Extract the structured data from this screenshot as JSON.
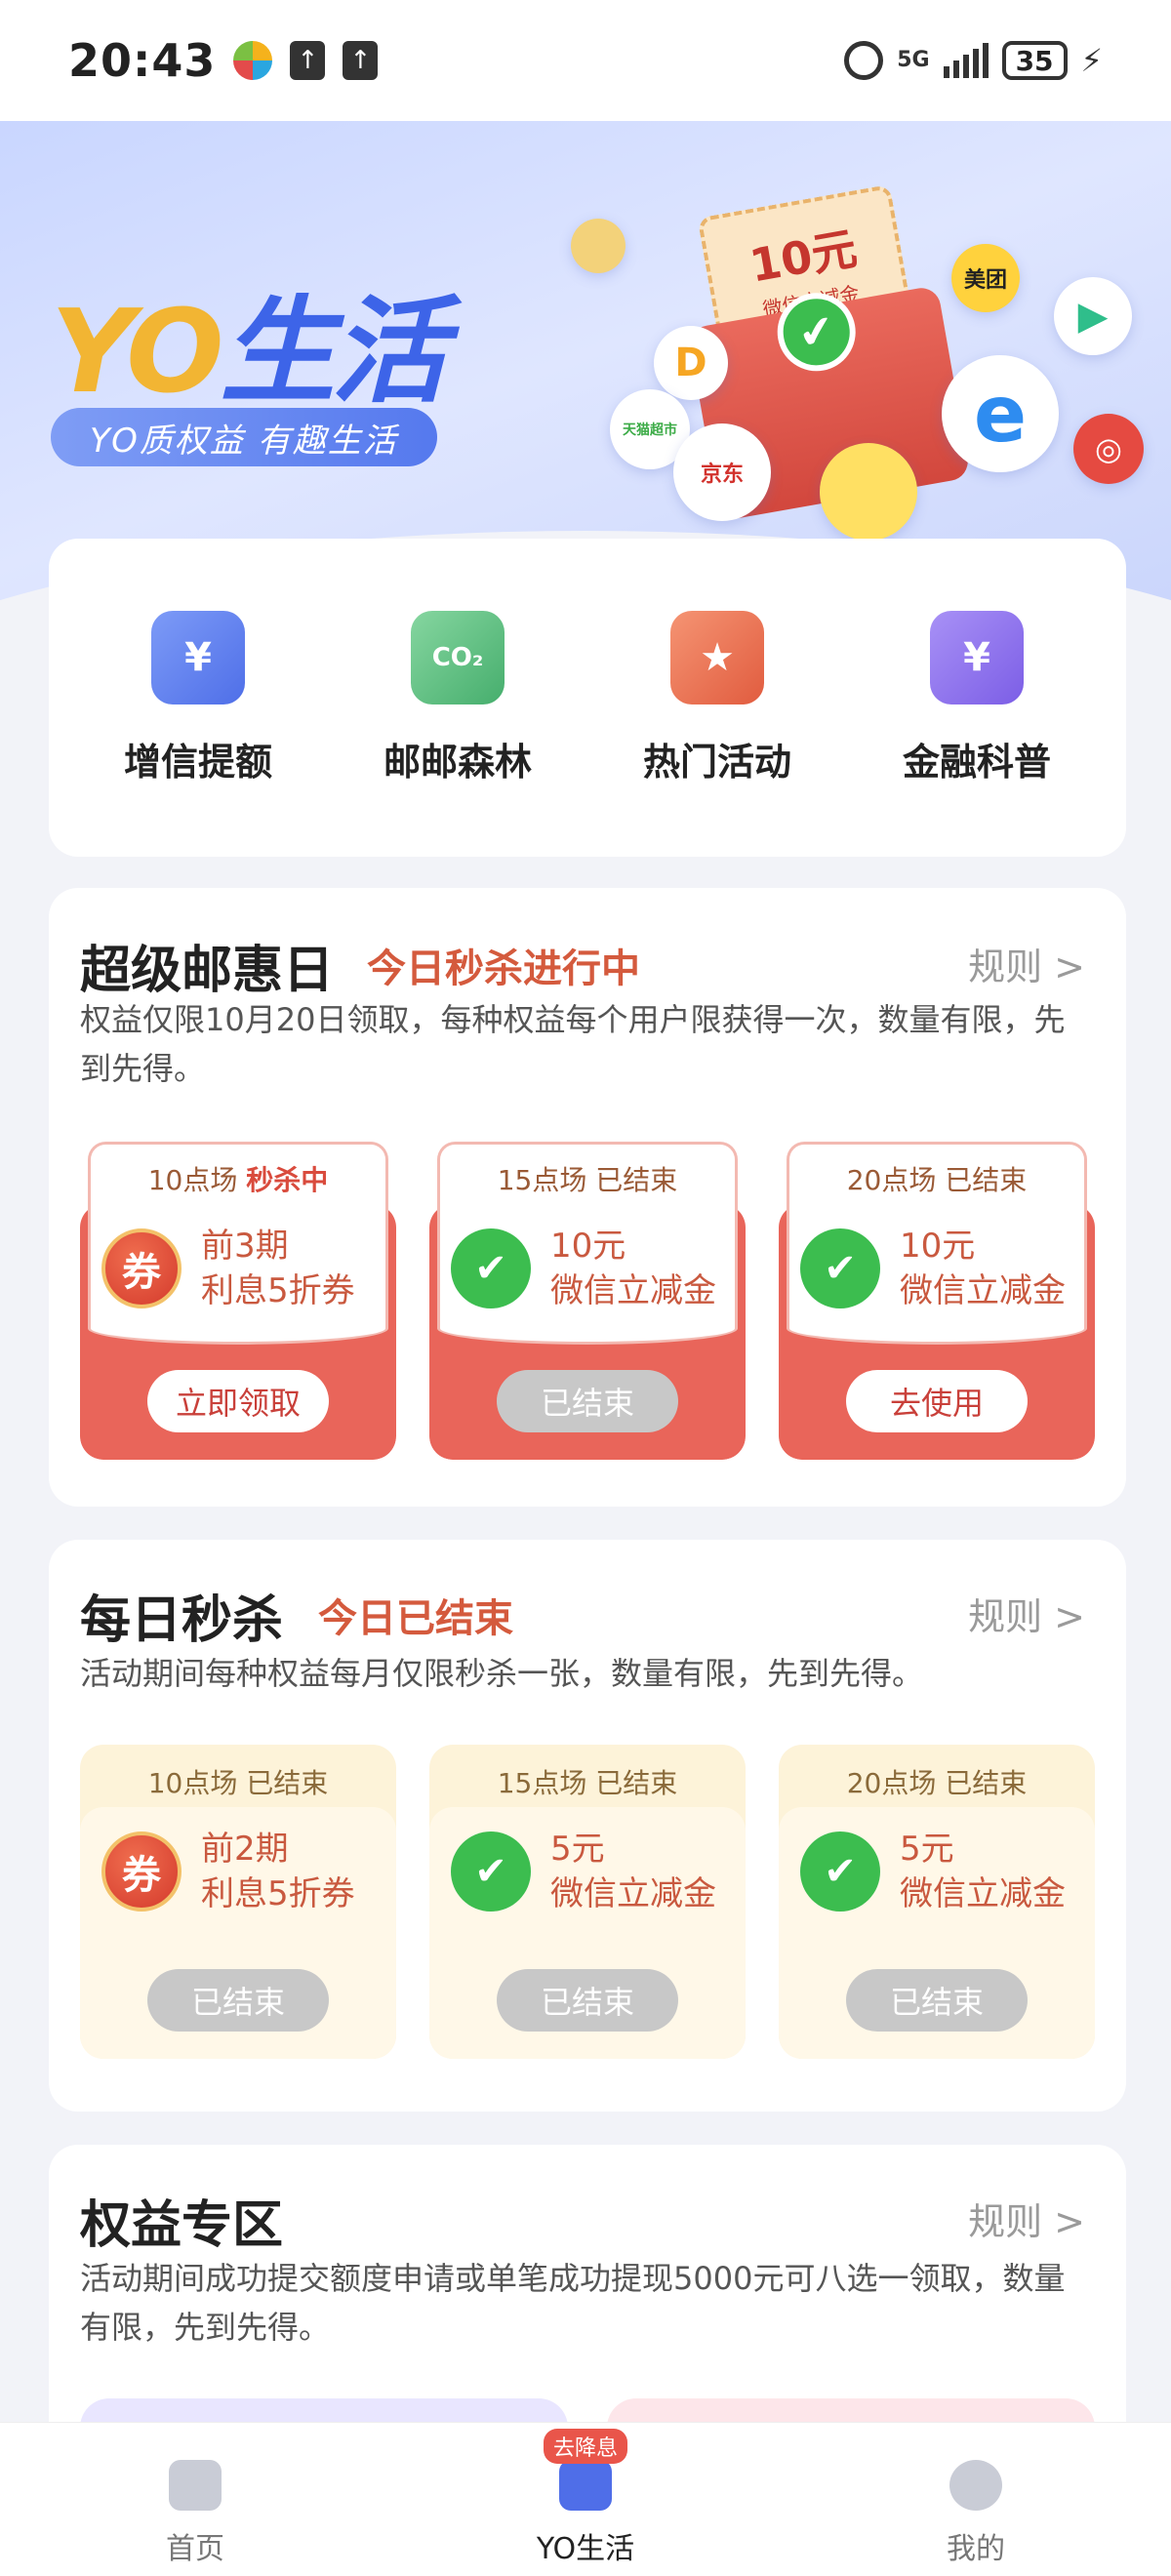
{
  "status_bar": {
    "time": "20:43",
    "network": "5G",
    "battery": "35"
  },
  "banner": {
    "title_part1": "YO",
    "title_part2": "生活",
    "slogan": "YO质权益 有趣生活",
    "coupon_amount": "10元",
    "coupon_caption": "微信立减金",
    "partner_meituan": "美团",
    "partner_jd": "京东",
    "partner_tmall": "天猫超市"
  },
  "quick_actions": [
    {
      "label": "增信提额",
      "icon": "wallet-icon",
      "color": "#5a7df0"
    },
    {
      "label": "邮邮森林",
      "icon": "co2-cloud-icon",
      "color": "#53b77a"
    },
    {
      "label": "热门活动",
      "icon": "bookmark-star-icon",
      "color": "#ea6b4d"
    },
    {
      "label": "金融科普",
      "icon": "finance-search-icon",
      "color": "#8b6ae8"
    }
  ],
  "super_day": {
    "title": "超级邮惠日",
    "status": "今日秒杀进行中",
    "rule": "规则 >",
    "desc": "权益仅限10月20日领取，每种权益每个用户限获得一次，数量有限，先到先得。",
    "slots": [
      {
        "time": "10点场",
        "state": "秒杀中",
        "line1": "前3期",
        "line2": "利息5折券",
        "icon": "券",
        "button": "立即领取"
      },
      {
        "time": "15点场",
        "state": "已结束",
        "line1": "10元",
        "line2": "微信立减金",
        "icon": "✔",
        "button": "已结束"
      },
      {
        "time": "20点场",
        "state": "已结束",
        "line1": "10元",
        "line2": "微信立减金",
        "icon": "✔",
        "button": "去使用"
      }
    ]
  },
  "daily_flash": {
    "title": "每日秒杀",
    "status": "今日已结束",
    "rule": "规则 >",
    "desc": "活动期间每种权益每月仅限秒杀一张，数量有限，先到先得。",
    "slots": [
      {
        "time": "10点场",
        "state": "已结束",
        "line1": "前2期",
        "line2": "利息5折券",
        "icon": "券",
        "button": "已结束"
      },
      {
        "time": "15点场",
        "state": "已结束",
        "line1": "5元",
        "line2": "微信立减金",
        "icon": "✔",
        "button": "已结束"
      },
      {
        "time": "20点场",
        "state": "已结束",
        "line1": "5元",
        "line2": "微信立减金",
        "icon": "✔",
        "button": "已结束"
      }
    ]
  },
  "benefits": {
    "title": "权益专区",
    "rule": "规则 >",
    "desc": "活动期间成功提交额度申请或单笔成功提现5000元可八选一领取，数量有限，先到先得。"
  },
  "tabbar": {
    "items": [
      {
        "label": "首页"
      },
      {
        "label": "YO生活",
        "badge": "去降息"
      },
      {
        "label": "我的"
      }
    ]
  }
}
